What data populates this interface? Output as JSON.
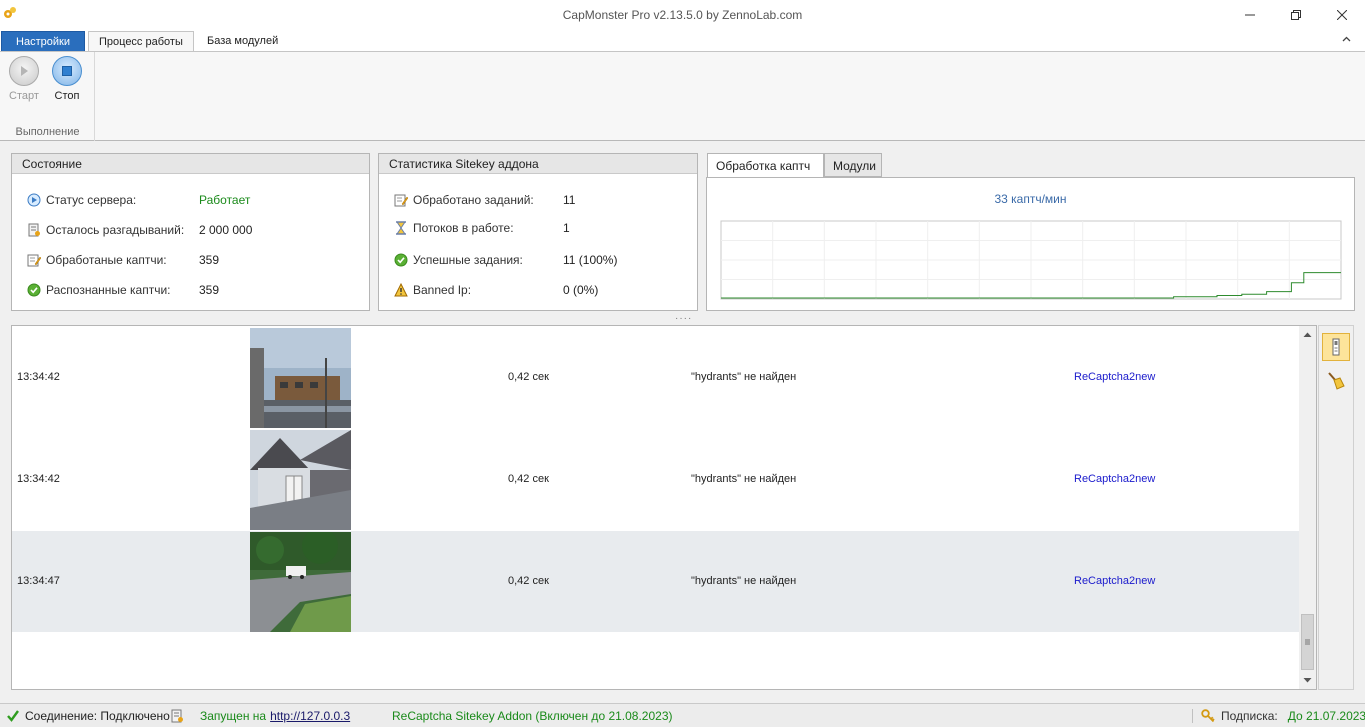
{
  "window": {
    "title": "CapMonster Pro v2.13.5.0 by ZennoLab.com"
  },
  "ribbon": {
    "tabs": [
      "Настройки",
      "Процесс работы",
      "База модулей"
    ],
    "start_label": "Старт",
    "stop_label": "Стоп",
    "group_label": "Выполнение"
  },
  "state_panel": {
    "title": "Состояние",
    "rows": [
      {
        "label": "Статус сервера:",
        "value": "Работает",
        "icon": "play-status-icon"
      },
      {
        "label": "Осталось разгадываний:",
        "value": "2 000 000",
        "icon": "counter-icon"
      },
      {
        "label": "Обработаные каптчи:",
        "value": "359",
        "icon": "edit-doc-icon"
      },
      {
        "label": "Распознанные каптчи:",
        "value": "359",
        "icon": "check-icon"
      }
    ]
  },
  "addon_panel": {
    "title": "Статистика Sitekey аддона",
    "rows": [
      {
        "label": "Обработано заданий:",
        "value": "11",
        "icon": "edit-doc-icon"
      },
      {
        "label": "Потоков в работе:",
        "value": "1",
        "icon": "hourglass-icon"
      },
      {
        "label": "Успешные задания:",
        "value": "11 (100%)",
        "icon": "check-icon"
      },
      {
        "label": "Banned Ip:",
        "value": "0 (0%)",
        "icon": "warning-icon"
      }
    ]
  },
  "chart_panel": {
    "tabs": [
      "Обработка каптч",
      "Модули"
    ],
    "rate_label": "33 каптч/мин"
  },
  "chart_data": {
    "type": "line",
    "title": "",
    "xlabel": "",
    "ylabel": "",
    "grid": true,
    "x": [
      0,
      10,
      20,
      30,
      40,
      50,
      60,
      70,
      73,
      76,
      80,
      84,
      88,
      92,
      94,
      100
    ],
    "series": [
      {
        "values": [
          0,
          0,
          0,
          0,
          0,
          0,
          0,
          0,
          1,
          1,
          2,
          3,
          5,
          12,
          20,
          20
        ]
      }
    ],
    "xlim": [
      0,
      100
    ],
    "ylim": [
      0,
      60
    ],
    "color": "#2e8b2e"
  },
  "log": {
    "rows": [
      {
        "time": "13:34:42",
        "duration": "0,42 сек",
        "result": "\"hydrants\" не найден",
        "module": "ReCaptcha2new",
        "scene": "building"
      },
      {
        "time": "13:34:42",
        "duration": "0,42 сек",
        "result": "\"hydrants\" не найден",
        "module": "ReCaptcha2new",
        "scene": "house"
      },
      {
        "time": "13:34:47",
        "duration": "0,42 сек",
        "result": "\"hydrants\" не найден",
        "module": "ReCaptcha2new",
        "scene": "road"
      }
    ]
  },
  "statusbar": {
    "connection": "Соединение: Подключено",
    "running_prefix": "Запущен на",
    "running_url": "http://127.0.0.3",
    "addon": "ReCaptcha Sitekey Addon (Включен до 21.08.2023)",
    "subscription_label": "Подписка:",
    "subscription_value": "До 21.07.2023"
  },
  "colors": {
    "accent": "#2a6ebd",
    "ok_green": "#1a8a1a",
    "link_blue": "#1a1acc",
    "rate_blue": "#3a6aa8"
  }
}
